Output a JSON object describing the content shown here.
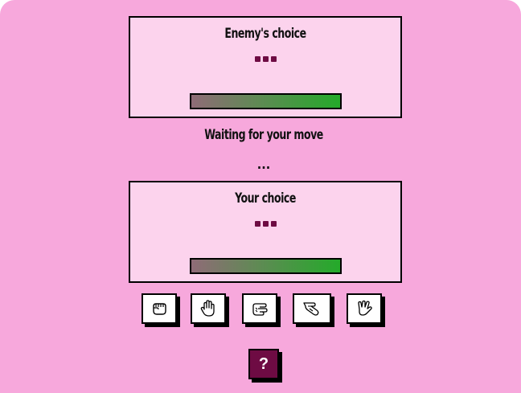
{
  "enemy": {
    "title": "Enemy's choice",
    "choice_placeholder": "dots",
    "bar_fill_percent": 100
  },
  "status": {
    "message": "Waiting for your move",
    "sub": "..."
  },
  "player": {
    "title": "Your choice",
    "choice_placeholder": "dots",
    "bar_fill_percent": 100
  },
  "moves": [
    {
      "name": "rock",
      "icon": "fist-icon"
    },
    {
      "name": "paper",
      "icon": "open-hand-icon"
    },
    {
      "name": "scissors",
      "icon": "scissors-hand-icon"
    },
    {
      "name": "lizard",
      "icon": "lizard-hand-icon"
    },
    {
      "name": "spock",
      "icon": "vulcan-salute-icon"
    }
  ],
  "help_button": {
    "label": "?"
  },
  "colors": {
    "background": "#f7a8dc",
    "panel": "#fcd3ed",
    "accent": "#6e0b43",
    "bar_start": "#8f6b77",
    "bar_end": "#24aa2a"
  }
}
